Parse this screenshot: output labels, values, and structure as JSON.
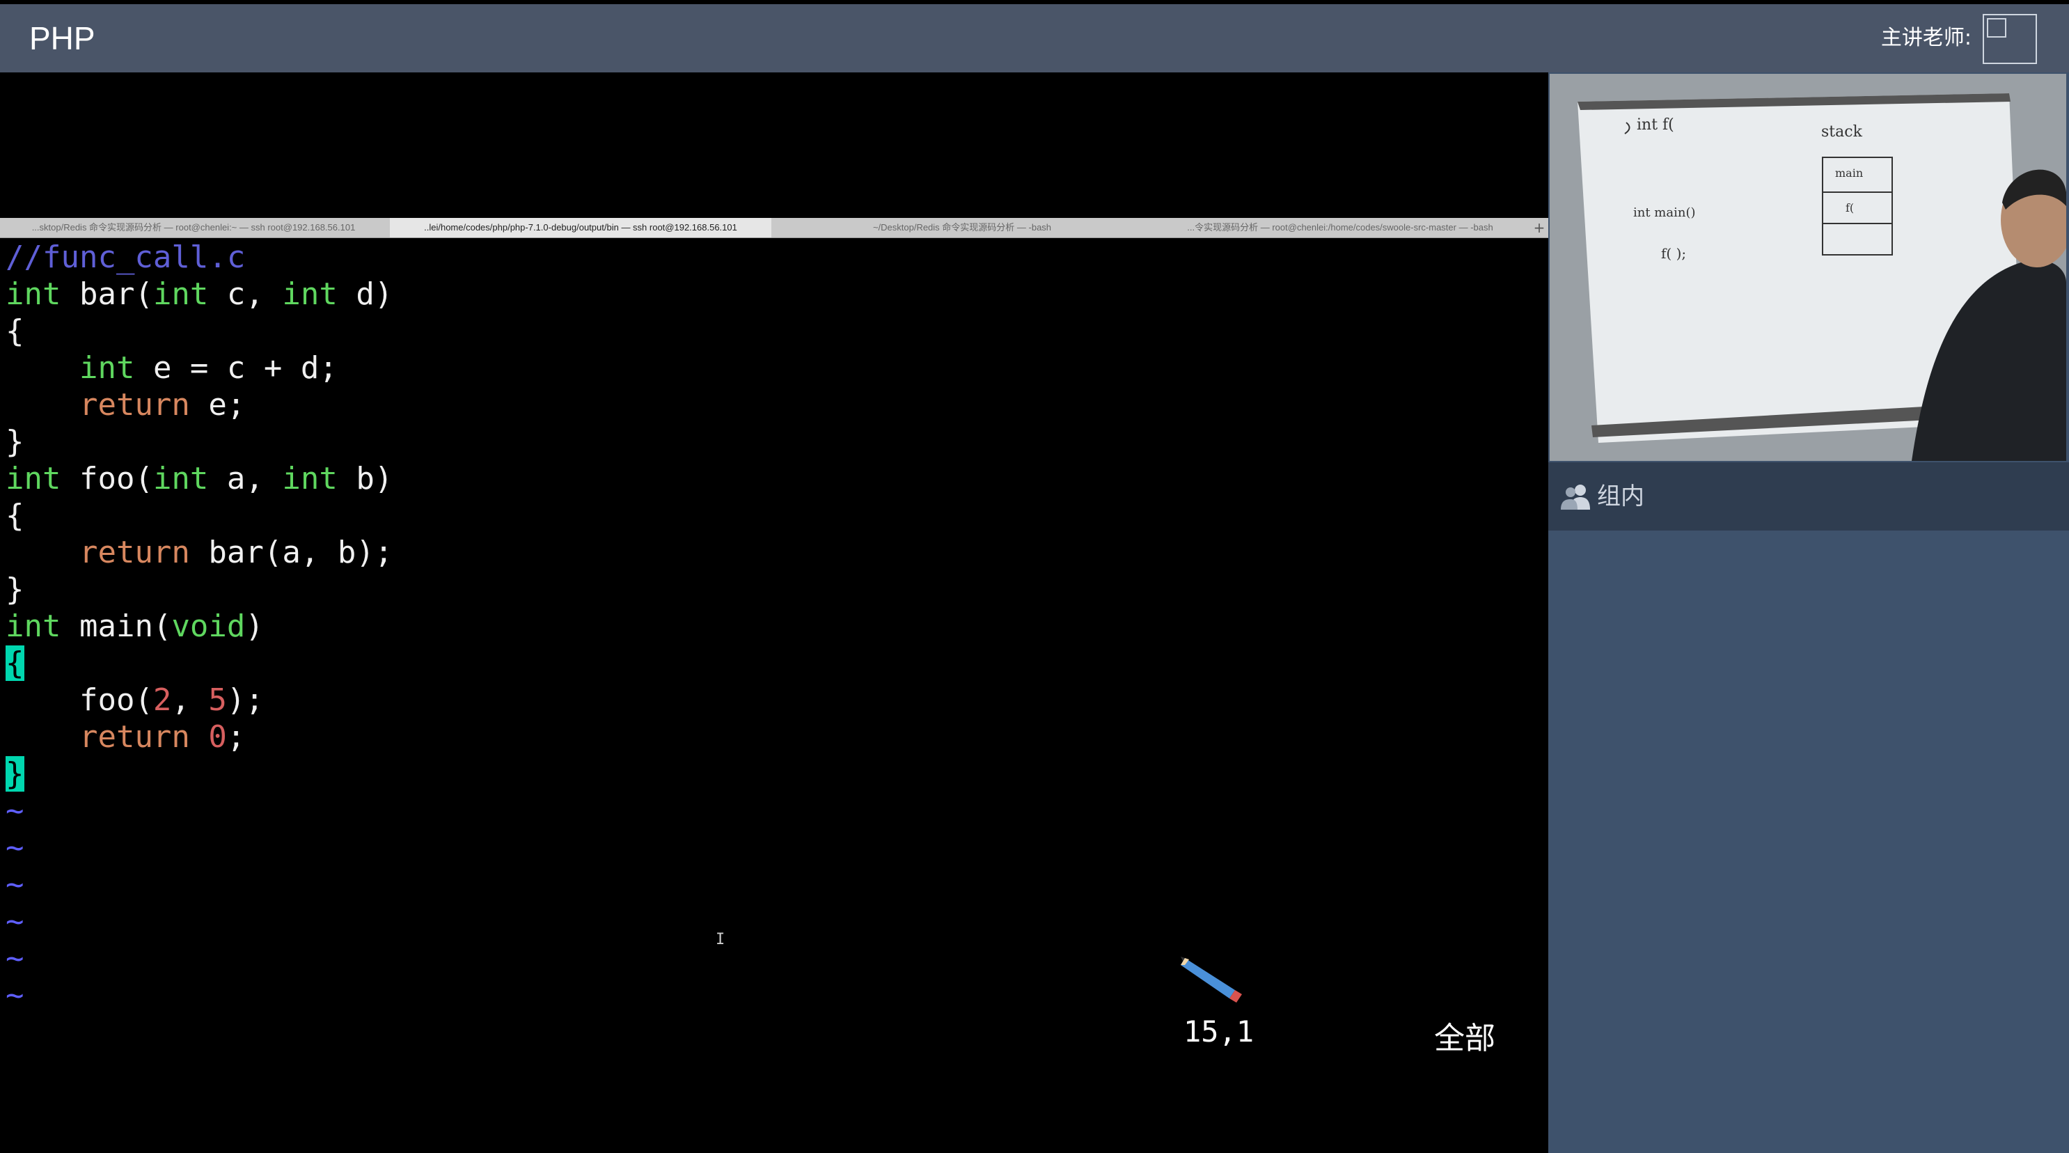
{
  "header": {
    "app_title": "PHP",
    "teacher_label": "主讲老师:"
  },
  "terminal": {
    "tabs": [
      "...sktop/Redis 命令实现源码分析 — root@chenlei:~ — ssh root@192.168.56.101",
      "..lei/home/codes/php/php-7.1.0-debug/output/bin — ssh root@192.168.56.101",
      "~/Desktop/Redis 命令实现源码分析 — -bash",
      "...令实现源码分析 — root@chenlei:/home/codes/swoole-src-master — -bash"
    ],
    "code_lines": [
      "//func_call.c",
      "int bar(int c, int d)",
      "{",
      "    int e = c + d;",
      "    return e;",
      "}",
      "int foo(int a, int b)",
      "{",
      "    return bar(a, b);",
      "}",
      "int main(void)",
      "{",
      "    foo(2, 5);",
      "    return 0;",
      "}"
    ],
    "empty_line_marker": "~",
    "cursor_position": "15,1",
    "scroll_status": "全部"
  },
  "sidebar": {
    "group_label": "组内"
  },
  "colors": {
    "title_bar": "#4a5568",
    "panel_bg": "#3e526c",
    "keyword": "#5fd75f",
    "return_keyword": "#d7875f",
    "number": "#d75f5f",
    "comment": "#5f5fd7",
    "cursor_block": "#00d7af"
  },
  "icons": {
    "group": "group-users-icon",
    "status_pencil": "pencil-icon",
    "new_tab": "plus-icon"
  }
}
